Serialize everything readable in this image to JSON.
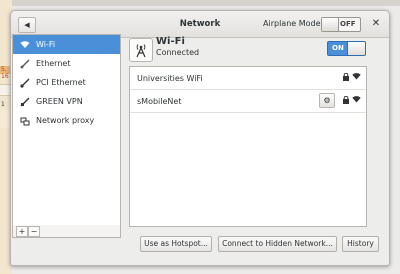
{
  "background": {
    "fragment_1": "5, 16",
    "fragment_2": "1"
  },
  "window": {
    "title": "Network",
    "back_icon": "back-arrow-icon",
    "airplane_mode_label": "Airplane Mode",
    "airplane_mode_state": "OFF",
    "close_icon": "close-icon"
  },
  "sidebar": {
    "items": [
      {
        "label": "Wi-Fi",
        "icon": "wifi-icon",
        "selected": true
      },
      {
        "label": "Ethernet",
        "icon": "ethernet-icon",
        "selected": false
      },
      {
        "label": "PCI Ethernet",
        "icon": "ethernet-icon",
        "selected": false
      },
      {
        "label": "GREEN VPN",
        "icon": "vpn-icon",
        "selected": false
      },
      {
        "label": "Network proxy",
        "icon": "proxy-icon",
        "selected": false
      }
    ],
    "add_label": "+",
    "remove_label": "−"
  },
  "main": {
    "title": "Wi-Fi",
    "status": "Connected",
    "toggle_state": "ON",
    "networks": [
      {
        "name": "Universities WiFi",
        "secured": true,
        "has_settings": false
      },
      {
        "name": "sMobileNet",
        "secured": true,
        "has_settings": true
      }
    ],
    "buttons": {
      "hotspot": "Use as Hotspot...",
      "hidden": "Connect to Hidden Network...",
      "history": "History"
    }
  },
  "colors": {
    "accent": "#4a90d9",
    "window_bg": "#ededec"
  }
}
